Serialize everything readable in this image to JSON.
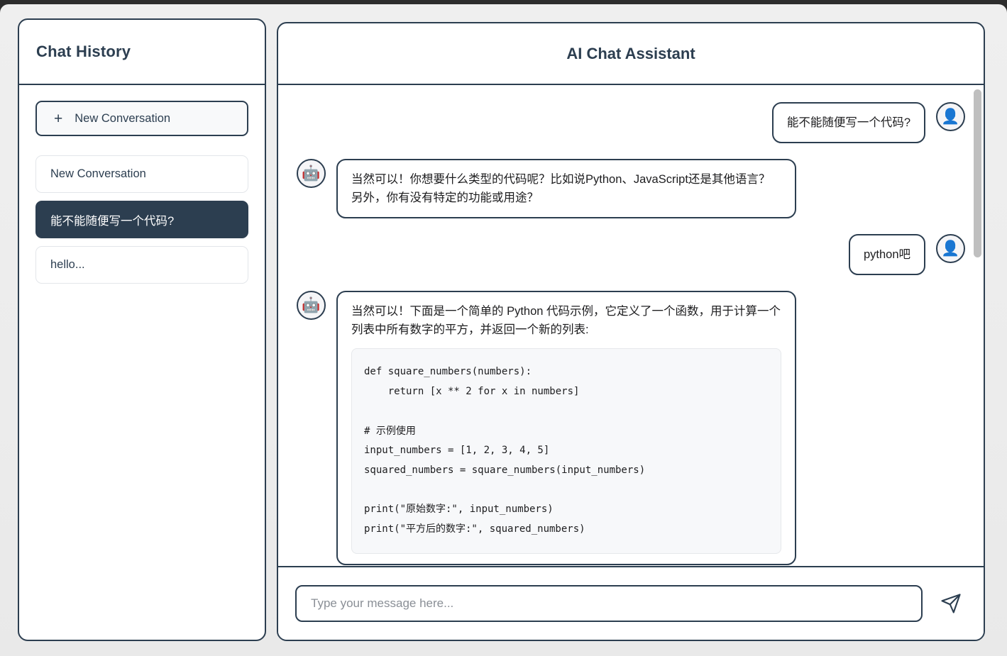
{
  "sidebar": {
    "title": "Chat History",
    "new_conversation": {
      "icon": "plus-icon",
      "label": "New Conversation"
    },
    "conversations": [
      {
        "label": "New Conversation",
        "selected": false
      },
      {
        "label": "能不能随便写一个代码?",
        "selected": true
      },
      {
        "label": "hello...",
        "selected": false
      }
    ]
  },
  "chat": {
    "title": "AI Chat Assistant",
    "user_avatar_icon": "user-avatar-icon",
    "bot_avatar_icon": "robot-avatar-icon",
    "messages": [
      {
        "role": "user",
        "text": "能不能随便写一个代码?"
      },
      {
        "role": "assistant",
        "text": "当然可以！你想要什么类型的代码呢？比如说Python、JavaScript还是其他语言？另外，你有没有特定的功能或用途？"
      },
      {
        "role": "user",
        "text": "python吧"
      },
      {
        "role": "assistant",
        "text": "当然可以！下面是一个简单的 Python 代码示例，它定义了一个函数，用于计算一个列表中所有数字的平方，并返回一个新的列表:",
        "code": "def square_numbers(numbers):\n    return [x ** 2 for x in numbers]\n\n# 示例使用\ninput_numbers = [1, 2, 3, 4, 5]\nsquared_numbers = square_numbers(input_numbers)\n\nprint(\"原始数字:\", input_numbers)\nprint(\"平方后的数字:\", squared_numbers)"
      }
    ]
  },
  "composer": {
    "placeholder": "Type your message here...",
    "value": "",
    "send_icon": "send-paper-plane-icon"
  },
  "colors": {
    "accent": "#2c3e50",
    "panel_background": "#ffffff",
    "page_background": "#ececec",
    "code_background": "#f7f8fa",
    "scrollbar_thumb": "#bfbfbf"
  }
}
